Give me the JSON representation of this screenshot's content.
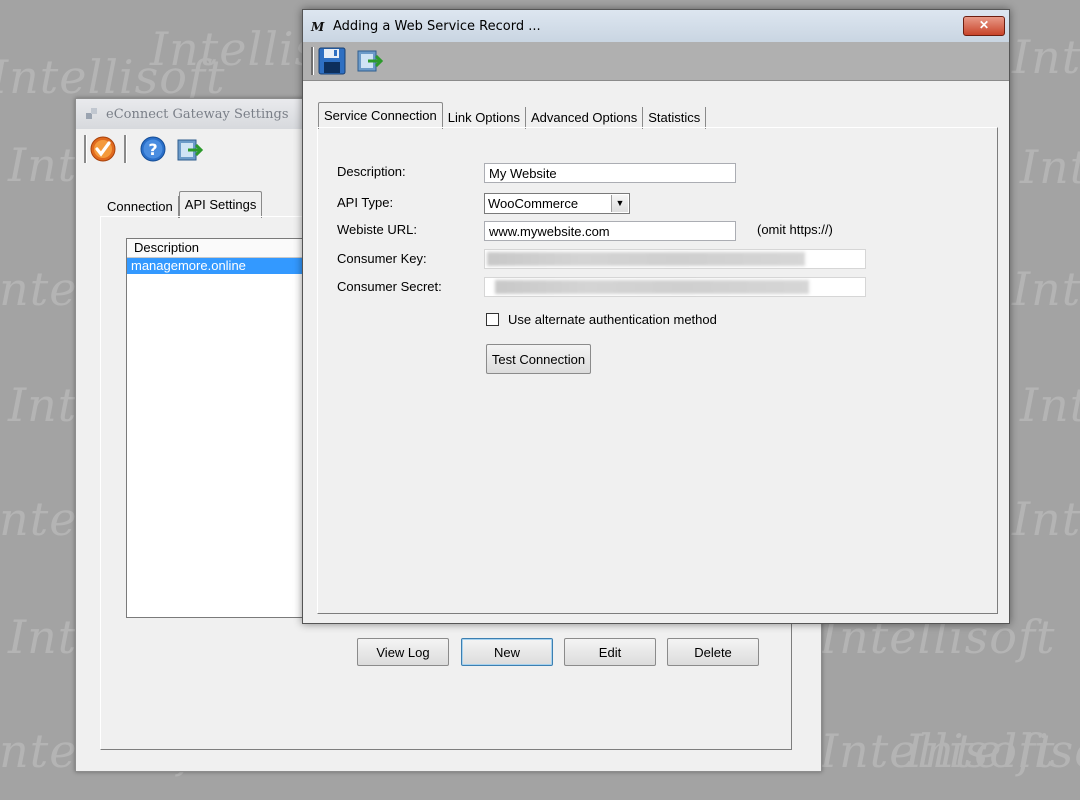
{
  "watermark": {
    "text": "Intellisoft"
  },
  "back_window": {
    "title": "eConnect Gateway Settings",
    "toolbar": {
      "icons": [
        "checkmark-icon",
        "help-icon",
        "exit-icon"
      ]
    },
    "tabs": [
      {
        "label": "Connection"
      },
      {
        "label": "API Settings",
        "active": true
      }
    ],
    "list": {
      "header": "Description",
      "rows": [
        {
          "label": "managemore.online",
          "selected": true
        }
      ]
    },
    "buttons": {
      "view_log": "View Log",
      "new": "New",
      "edit": "Edit",
      "delete": "Delete"
    }
  },
  "front_window": {
    "title": "Adding a Web Service Record ...",
    "logo_text": "M",
    "close_label": "✕",
    "toolbar": {
      "icons": [
        "save-icon",
        "exit-icon"
      ]
    },
    "tabs": [
      {
        "label": "Service Connection",
        "active": true
      },
      {
        "label": "Link Options"
      },
      {
        "label": "Advanced Options"
      },
      {
        "label": "Statistics"
      }
    ],
    "form": {
      "description": {
        "label": "Description:",
        "value": "My Website"
      },
      "api_type": {
        "label": "API Type:",
        "value": "WooCommerce"
      },
      "website_url": {
        "label": "Webiste URL:",
        "value": "www.mywebsite.com",
        "hint": "(omit https://)"
      },
      "consumer_key": {
        "label": "Consumer Key:",
        "value": ""
      },
      "consumer_secret": {
        "label": "Consumer Secret:",
        "value": ""
      },
      "alt_auth": {
        "label": "Use alternate authentication method",
        "checked": false
      },
      "test_connection": "Test Connection"
    }
  }
}
